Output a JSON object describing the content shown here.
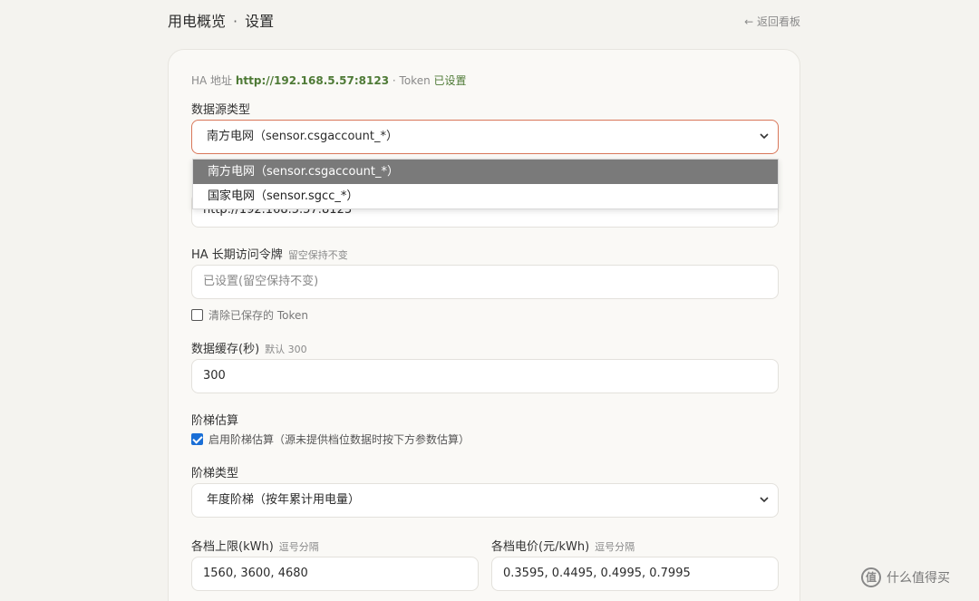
{
  "header": {
    "title": "用电概览",
    "separator": "·",
    "subtitle": "设置",
    "back_link": "← 返回看板"
  },
  "ha_info": {
    "prefix": "HA 地址",
    "url": "http://192.168.5.57:8123",
    "token_text": "· Token",
    "token_status": "已设置"
  },
  "data_source": {
    "label": "数据源类型",
    "selected": "南方电网（sensor.csgaccount_*）",
    "options": [
      "南方电网（sensor.csgaccount_*）",
      "国家电网（sensor.sgcc_*）"
    ]
  },
  "ha_address": {
    "value": "http://192.168.5.57:8123"
  },
  "token": {
    "label": "HA 长期访问令牌",
    "hint": "留空保持不变",
    "placeholder": "已设置(留空保持不变)",
    "clear_label": "清除已保存的 Token",
    "clear_checked": false
  },
  "cache": {
    "label": "数据缓存(秒)",
    "hint": "默认 300",
    "value": "300"
  },
  "tier": {
    "section_label": "阶梯估算",
    "enable_label": "启用阶梯估算（源未提供档位数据时按下方参数估算）",
    "enable_checked": true,
    "type_label": "阶梯类型",
    "type_selected": "年度阶梯（按年累计用电量）",
    "limits_label": "各档上限(kWh)",
    "limits_hint": "逗号分隔",
    "limits_value": "1560, 3600, 4680",
    "prices_label": "各档电价(元/kWh)",
    "prices_hint": "逗号分隔",
    "prices_value": "0.3595, 0.4495, 0.4995, 0.7995"
  },
  "watermark": {
    "icon_text": "值",
    "text": "什么值得买"
  },
  "colors": {
    "accent_green": "#4e7a36",
    "focus_border": "#d9775a",
    "checkbox_blue": "#1a6fd6",
    "background": "#f4f3ef"
  }
}
